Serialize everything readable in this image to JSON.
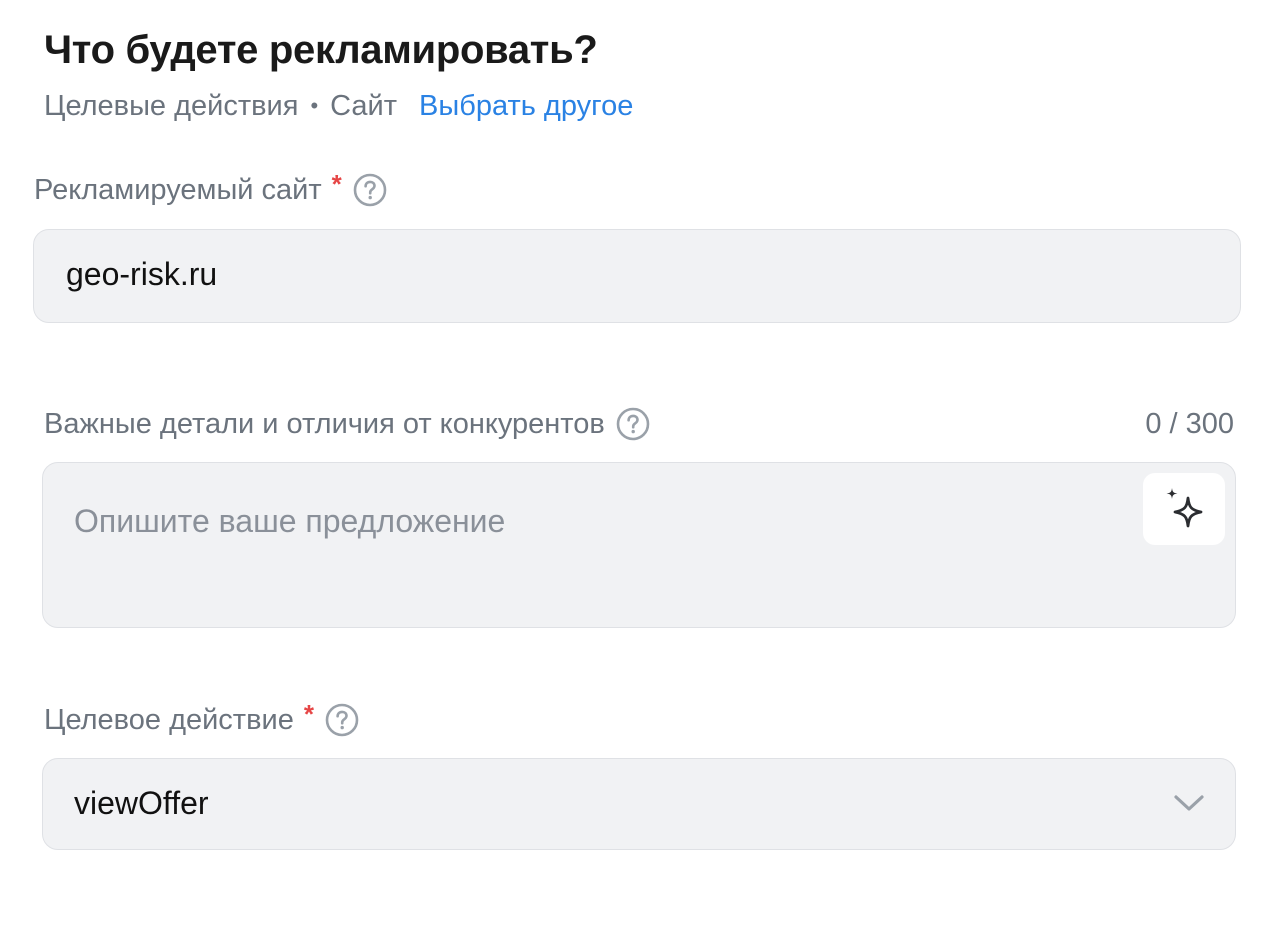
{
  "header": {
    "title": "Что будете рекламировать?",
    "subtitle_part1": "Целевые действия",
    "separator": "•",
    "subtitle_part2": "Сайт",
    "change_link": "Выбрать другое"
  },
  "site_field": {
    "label": "Рекламируемый сайт",
    "required_mark": "*",
    "value": "geo-risk.ru",
    "help_icon": "question-circle-icon"
  },
  "details_field": {
    "label": "Важные детали и отличия от конкурентов",
    "counter": "0 / 300",
    "placeholder": "Опишите ваше предложение",
    "value": "",
    "help_icon": "question-circle-icon",
    "ai_icon": "sparkles-icon"
  },
  "action_field": {
    "label": "Целевое действие",
    "required_mark": "*",
    "selected": "viewOffer",
    "help_icon": "question-circle-icon",
    "dropdown_icon": "chevron-down-icon"
  },
  "colors": {
    "accent_link": "#2a82e4",
    "required": "#e64646",
    "muted_text": "#6b737d",
    "input_bg": "#f1f2f4"
  }
}
